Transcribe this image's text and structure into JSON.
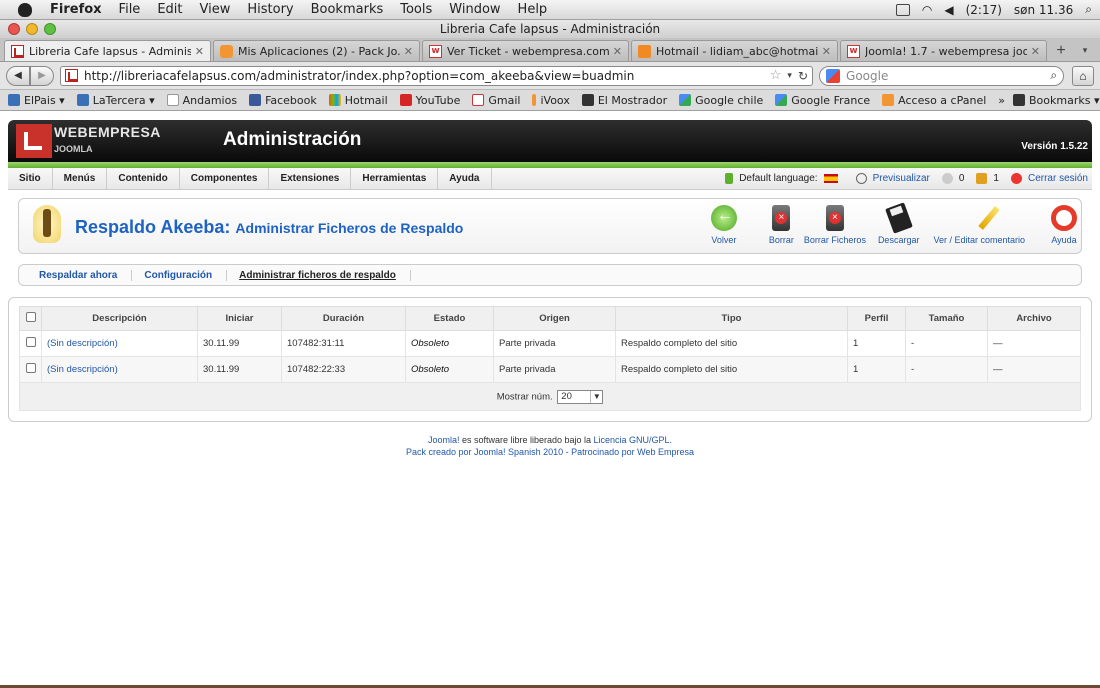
{
  "menubar": {
    "app": "Firefox",
    "items": [
      "File",
      "Edit",
      "View",
      "History",
      "Bookmarks",
      "Tools",
      "Window",
      "Help"
    ],
    "battery": "(2:17)",
    "clock": "søn 11.36"
  },
  "window": {
    "title": "Libreria Cafe lapsus - Administración"
  },
  "tabs": [
    {
      "label": "Libreria Cafe lapsus - Adminis...",
      "active": true
    },
    {
      "label": "Mis Aplicaciones (2) - Pack Jo...",
      "active": false
    },
    {
      "label": "Ver Ticket - webempresa.com",
      "active": false
    },
    {
      "label": "Hotmail - lidiam_abc@hotmail....",
      "active": false
    },
    {
      "label": "Joomla! 1.7 - webempresa joo...",
      "active": false
    }
  ],
  "nav": {
    "url": "http://libreriacafelapsus.com/administrator/index.php?option=com_akeeba&view=buadmin",
    "search_placeholder": "Google"
  },
  "bookmarks": {
    "items": [
      "ElPais",
      "LaTercera",
      "Andamios",
      "Facebook",
      "Hotmail",
      "YouTube",
      "Gmail",
      "iVoox",
      "El Mostrador",
      "Google chile",
      "Google France",
      "Acceso a cPanel"
    ],
    "more": "»",
    "folder": "Bookmarks"
  },
  "joomla": {
    "brand": "WEBEMPRESA",
    "brand_sub": "JOOMLA",
    "title": "Administración",
    "version": "Versión 1.5.22",
    "menu": [
      "Sitio",
      "Menús",
      "Contenido",
      "Componentes",
      "Extensiones",
      "Herramientas",
      "Ayuda"
    ],
    "status": {
      "default_language": "Default language:",
      "preview": "Previsualizar",
      "messages": "0",
      "users": "1",
      "logout": "Cerrar sesión"
    }
  },
  "toolbar": {
    "title_main": "Respaldo Akeeba:",
    "title_sub": "Administrar Ficheros de Respaldo",
    "buttons": [
      "Volver",
      "Borrar",
      "Borrar Ficheros",
      "Descargar",
      "Ver / Editar comentario",
      "Ayuda"
    ]
  },
  "subnav": [
    "Respaldar ahora",
    "Configuración",
    "Administrar ficheros de respaldo"
  ],
  "table": {
    "headers": [
      "Descripción",
      "Iniciar",
      "Duración",
      "Estado",
      "Origen",
      "Tipo",
      "Perfil",
      "Tamaño",
      "Archivo"
    ],
    "rows": [
      [
        "(Sin descripción)",
        "30.11.99",
        "107482:31:11",
        "Obsoleto",
        "Parte privada",
        "Respaldo completo del sitio",
        "1",
        "-",
        "—"
      ],
      [
        "(Sin descripción)",
        "30.11.99",
        "107482:22:33",
        "Obsoleto",
        "Parte privada",
        "Respaldo completo del sitio",
        "1",
        "-",
        "—"
      ]
    ],
    "limit_label": "Mostrar núm.",
    "limit_value": "20"
  },
  "footer": {
    "line1_link": "Joomla!",
    "line1_text": " es software libre liberado bajo la ",
    "line1_link2": "Licencia GNU/GPL.",
    "line2": "Pack creado por Joomla! Spanish 2010 - Patrocinado por Web Empresa"
  }
}
